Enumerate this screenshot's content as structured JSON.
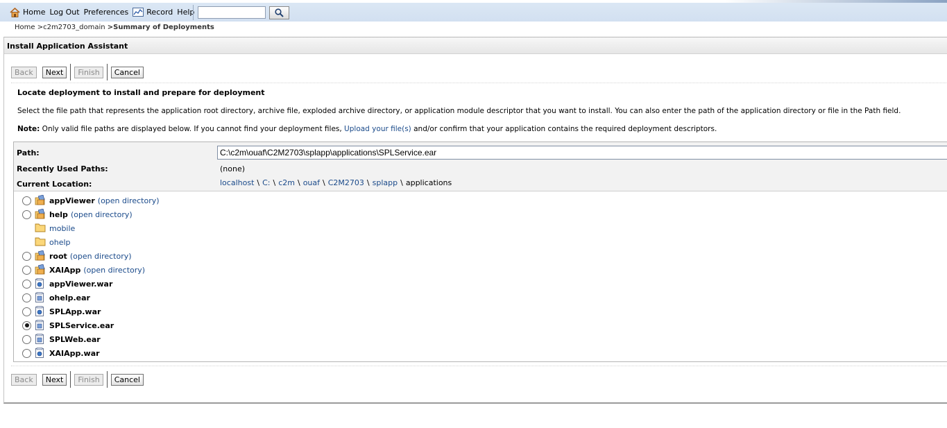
{
  "nav": {
    "home": "Home",
    "logout": "Log Out",
    "preferences": "Preferences",
    "record": "Record",
    "help": "Help",
    "search_value": ""
  },
  "breadcrumb": {
    "home": "Home",
    "domain": ">c2m2703_domain",
    "current": ">Summary of Deployments"
  },
  "panel": {
    "title": "Install Application Assistant",
    "buttons": {
      "back": "Back",
      "next": "Next",
      "finish": "Finish",
      "cancel": "Cancel"
    },
    "section_title": "Locate deployment to install and prepare for deployment",
    "description": "Select the file path that represents the application root directory, archive file, exploded archive directory, or application module descriptor that you want to install. You can also enter the path of the application directory or file in the Path field.",
    "note_label": "Note:",
    "note_before": " Only valid file paths are displayed below. If you cannot find your deployment files, ",
    "note_link": "Upload your file(s)",
    "note_after": " and/or confirm that your application contains the required deployment descriptors."
  },
  "path": {
    "path_label": "Path:",
    "path_value": "C:\\c2m\\ouaf\\C2M2703\\splapp\\applications\\SPLService.ear",
    "recent_label": "Recently Used Paths:",
    "recent_value": "(none)",
    "location_label": "Current Location:",
    "location_crumbs": [
      "localhost",
      "C:",
      "c2m",
      "ouaf",
      "C2M2703",
      "splapp"
    ],
    "location_separator": "\\",
    "location_current": "applications"
  },
  "files": [
    {
      "name": "appViewer",
      "type": "app-dir",
      "radio": true,
      "checked": false,
      "open": "(open directory)"
    },
    {
      "name": "help",
      "type": "app-dir",
      "radio": true,
      "checked": false,
      "open": "(open directory)"
    },
    {
      "name": "mobile",
      "type": "folder",
      "radio": false,
      "checked": false,
      "open": ""
    },
    {
      "name": "ohelp",
      "type": "folder",
      "radio": false,
      "checked": false,
      "open": ""
    },
    {
      "name": "root",
      "type": "app-dir",
      "radio": true,
      "checked": false,
      "open": "(open directory)"
    },
    {
      "name": "XAIApp",
      "type": "app-dir",
      "radio": true,
      "checked": false,
      "open": "(open directory)"
    },
    {
      "name": "appViewer.war",
      "type": "war",
      "radio": true,
      "checked": false,
      "open": ""
    },
    {
      "name": "ohelp.ear",
      "type": "ear",
      "radio": true,
      "checked": false,
      "open": ""
    },
    {
      "name": "SPLApp.war",
      "type": "war",
      "radio": true,
      "checked": false,
      "open": ""
    },
    {
      "name": "SPLService.ear",
      "type": "ear",
      "radio": true,
      "checked": true,
      "open": ""
    },
    {
      "name": "SPLWeb.ear",
      "type": "ear",
      "radio": true,
      "checked": false,
      "open": ""
    },
    {
      "name": "XAIApp.war",
      "type": "war",
      "radio": true,
      "checked": false,
      "open": ""
    }
  ],
  "colors": {
    "header_bg": "#d6e3f3",
    "link": "#1a4a8a",
    "panel_head": "#ececec"
  }
}
